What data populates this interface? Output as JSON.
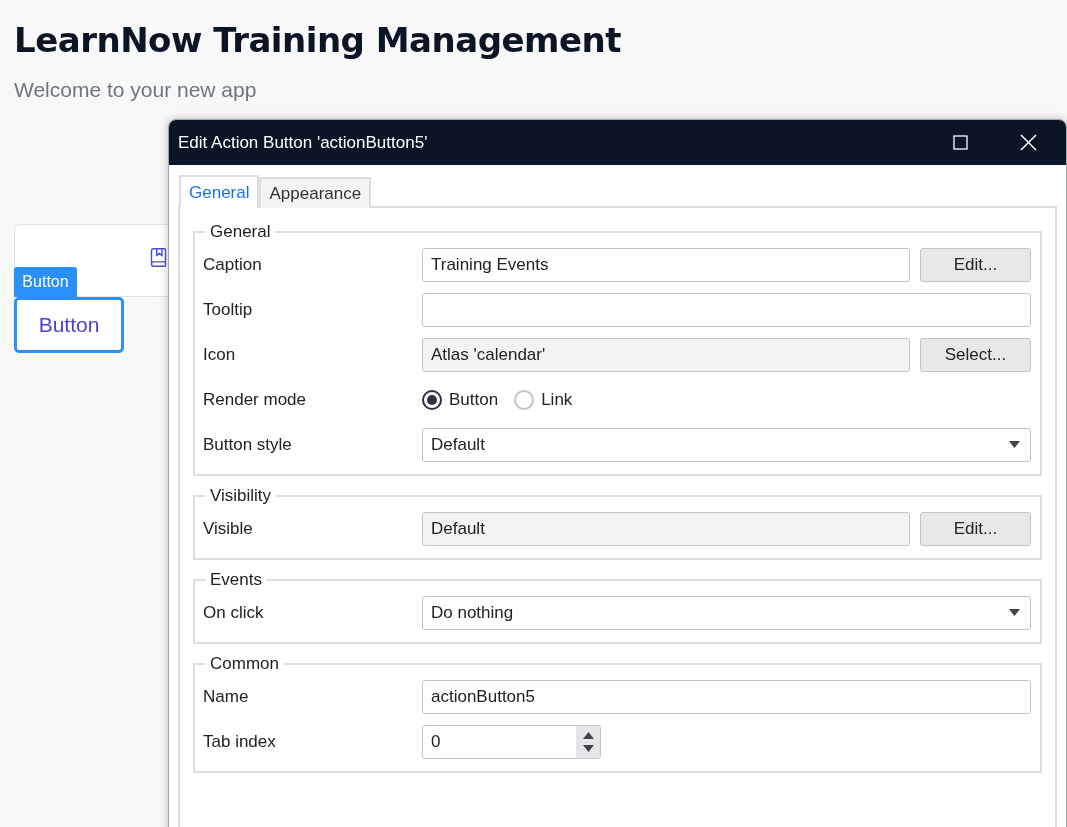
{
  "page": {
    "title": "LearnNow Training Management",
    "subtitle": "Welcome to your new app",
    "selected_widget": {
      "tag": "Button",
      "label": "Button"
    }
  },
  "dialog": {
    "title": "Edit Action Button 'actionButton5'",
    "tabs": [
      {
        "label": "General",
        "selected": true
      },
      {
        "label": "Appearance",
        "selected": false
      }
    ],
    "groups": [
      {
        "legend": "General",
        "fields": [
          {
            "kind": "text",
            "label": "Caption",
            "value": "Training Events",
            "button": "Edit..."
          },
          {
            "kind": "text",
            "label": "Tooltip"
          },
          {
            "kind": "readonly",
            "label": "Icon",
            "value": "Atlas 'calendar'",
            "button": "Select..."
          },
          {
            "kind": "radio",
            "label": "Render mode",
            "options": [
              {
                "label": "Button",
                "selected": true
              },
              {
                "label": "Link",
                "selected": false
              }
            ]
          },
          {
            "kind": "select",
            "label": "Button style",
            "value": "Default"
          }
        ]
      },
      {
        "legend": "Visibility",
        "fields": [
          {
            "kind": "readonly",
            "label": "Visible",
            "value": "Default",
            "button": "Edit..."
          }
        ]
      },
      {
        "legend": "Events",
        "fields": [
          {
            "kind": "select",
            "label": "On click",
            "value": "Do nothing"
          }
        ]
      },
      {
        "legend": "Common",
        "fields": [
          {
            "kind": "text",
            "label": "Name",
            "value": "actionButton5"
          },
          {
            "kind": "number",
            "label": "Tab index",
            "value": "0"
          }
        ]
      }
    ]
  }
}
